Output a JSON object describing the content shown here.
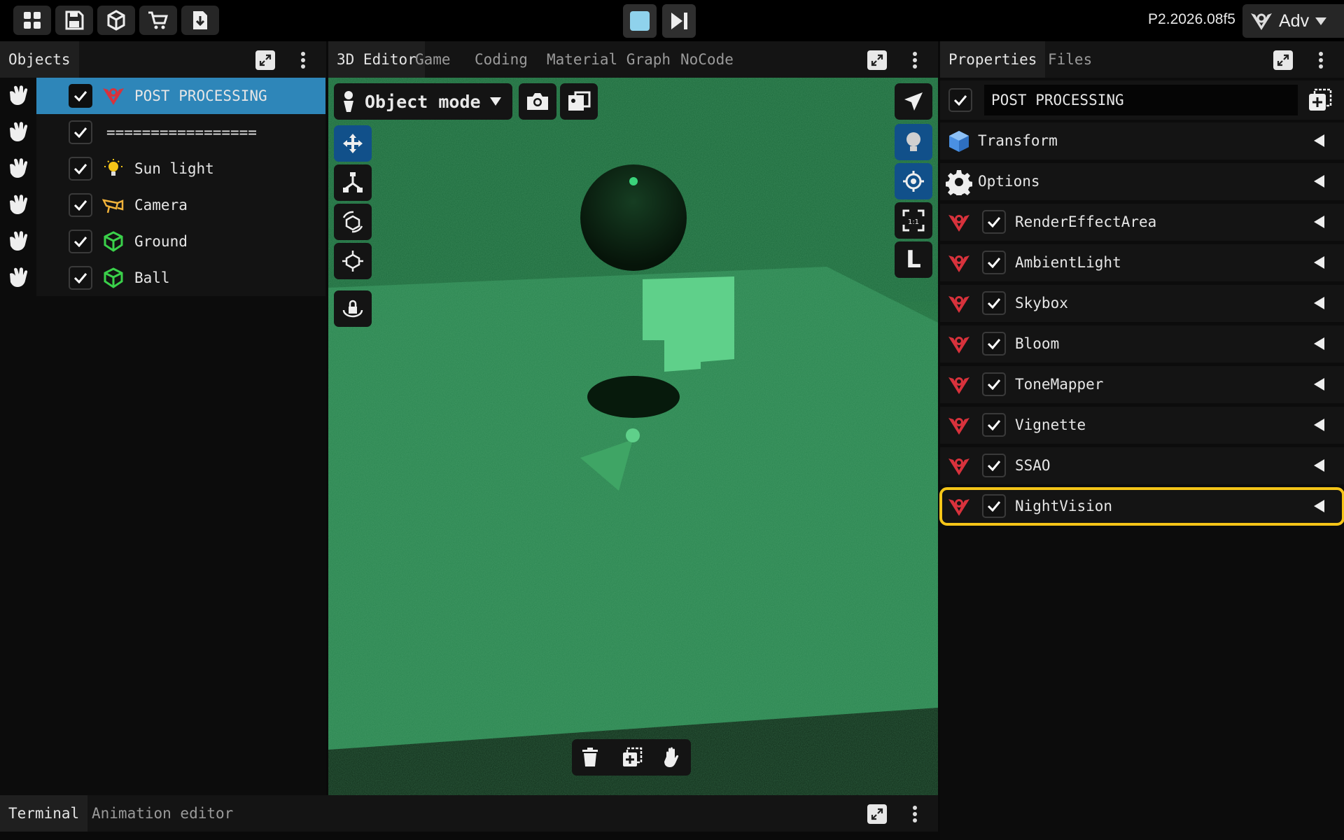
{
  "topbar": {
    "icons": [
      "grid-icon",
      "save-icon",
      "package-icon",
      "cart-icon",
      "download-icon"
    ],
    "play_controls": [
      "stop-icon",
      "step-forward-icon"
    ],
    "version": "P2.2026.08f5",
    "user_label": "Adv"
  },
  "objects_panel": {
    "tab_label": "Objects",
    "items": [
      {
        "label": "POST PROCESSING",
        "icon": "post-processing-icon",
        "checked": true,
        "selected": true
      },
      {
        "label": "=================",
        "icon": "",
        "checked": true,
        "selected": false
      },
      {
        "label": "Sun light",
        "icon": "bulb-icon",
        "checked": true,
        "selected": false
      },
      {
        "label": "Camera",
        "icon": "camera-object-icon",
        "checked": true,
        "selected": false
      },
      {
        "label": "Ground",
        "icon": "mesh-icon",
        "checked": true,
        "selected": false
      },
      {
        "label": "Ball",
        "icon": "mesh-icon",
        "checked": true,
        "selected": false
      }
    ]
  },
  "editor": {
    "tabs": [
      "3D Editor",
      "Game",
      "Coding",
      "Material Graph",
      "NoCode"
    ],
    "active_tab": "3D Editor",
    "mode": "Object mode",
    "left_tools": [
      "move-icon",
      "scale-icon",
      "rotate-icon",
      "transform-icon",
      "lock-icon"
    ],
    "right_tools": [
      "pointer-icon",
      "light-icon",
      "target-icon",
      "fit-icon"
    ],
    "right_letter": "L",
    "bottom_tools": [
      "trash-icon",
      "duplicate-icon",
      "hand-icon"
    ],
    "scene_tint": "#1f7040"
  },
  "properties_panel": {
    "tabs": [
      "Properties",
      "Files"
    ],
    "active_tab": "Properties",
    "name_value": "POST PROCESSING",
    "name_checked": true,
    "sections": [
      {
        "label": "Transform",
        "icon": "cube-icon",
        "checkbox": false
      },
      {
        "label": "Options",
        "icon": "gear-icon",
        "checkbox": false
      },
      {
        "label": "RenderEffectArea",
        "icon": "post-processing-icon",
        "checkbox": true
      },
      {
        "label": "AmbientLight",
        "icon": "post-processing-icon",
        "checkbox": true
      },
      {
        "label": "Skybox",
        "icon": "post-processing-icon",
        "checkbox": true
      },
      {
        "label": "Bloom",
        "icon": "post-processing-icon",
        "checkbox": true
      },
      {
        "label": "ToneMapper",
        "icon": "post-processing-icon",
        "checkbox": true
      },
      {
        "label": "Vignette",
        "icon": "post-processing-icon",
        "checkbox": true
      },
      {
        "label": "SSAO",
        "icon": "post-processing-icon",
        "checkbox": true
      },
      {
        "label": "NightVision",
        "icon": "post-processing-icon",
        "checkbox": true,
        "highlighted": true
      }
    ]
  },
  "bottom_panel": {
    "tabs": [
      "Terminal",
      "Animation editor"
    ],
    "active_tab": "Terminal"
  },
  "colors": {
    "selection": "#2e86b9",
    "highlight": "#f5c518",
    "accent_blue": "#11508a",
    "red_icon": "#d8323c",
    "green_icon": "#3ad14a"
  }
}
